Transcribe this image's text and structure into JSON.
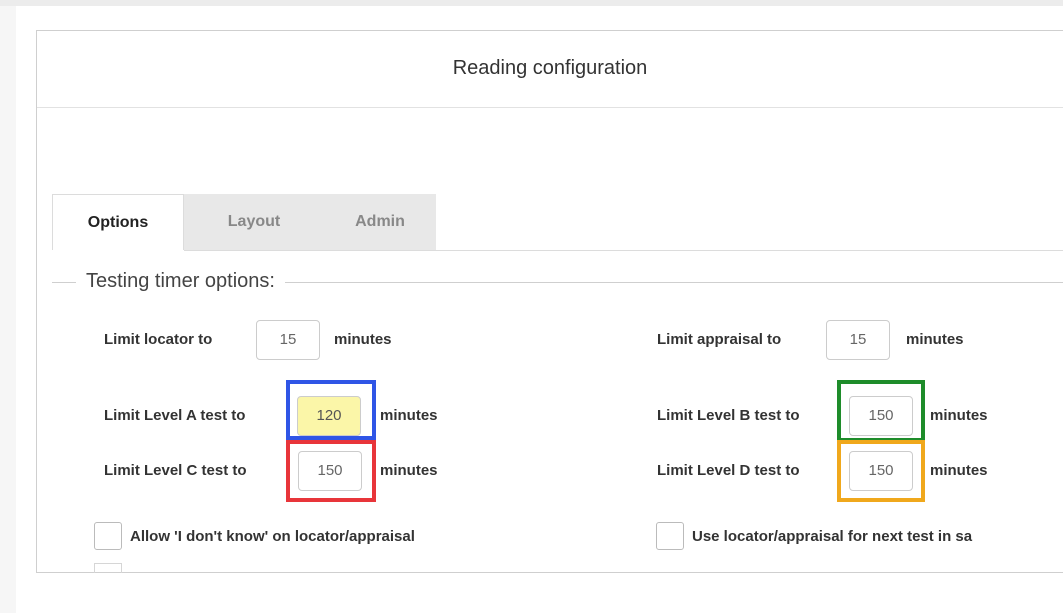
{
  "window": {
    "title": "Reading configuration"
  },
  "tabs": [
    {
      "label": "Options",
      "active": true
    },
    {
      "label": "Layout",
      "active": false
    },
    {
      "label": "Admin",
      "active": false
    }
  ],
  "section": {
    "legend": "Testing timer options:"
  },
  "fields": {
    "locator": {
      "label": "Limit locator to",
      "value": "15",
      "unit": "minutes"
    },
    "appraisal": {
      "label": "Limit appraisal to",
      "value": "15",
      "unit": "minutes"
    },
    "level_a": {
      "label": "Limit Level A test to",
      "value": "120",
      "unit": "minutes",
      "highlight": "#2f55e6"
    },
    "level_b": {
      "label": "Limit Level B test to",
      "value": "150",
      "unit": "minutes",
      "highlight": "#1e8c2a"
    },
    "level_c": {
      "label": "Limit Level C test to",
      "value": "150",
      "unit": "minutes",
      "highlight": "#e8353a"
    },
    "level_d": {
      "label": "Limit Level D test to",
      "value": "150",
      "unit": "minutes",
      "highlight": "#f0a81c"
    }
  },
  "checkboxes": [
    {
      "label": "Allow 'I don't know' on locator/appraisal",
      "checked": false
    },
    {
      "label": "Use locator/appraisal for next test in sa",
      "checked": false
    }
  ],
  "colors": {
    "level_a_input_bg": "#fbf6a8"
  }
}
